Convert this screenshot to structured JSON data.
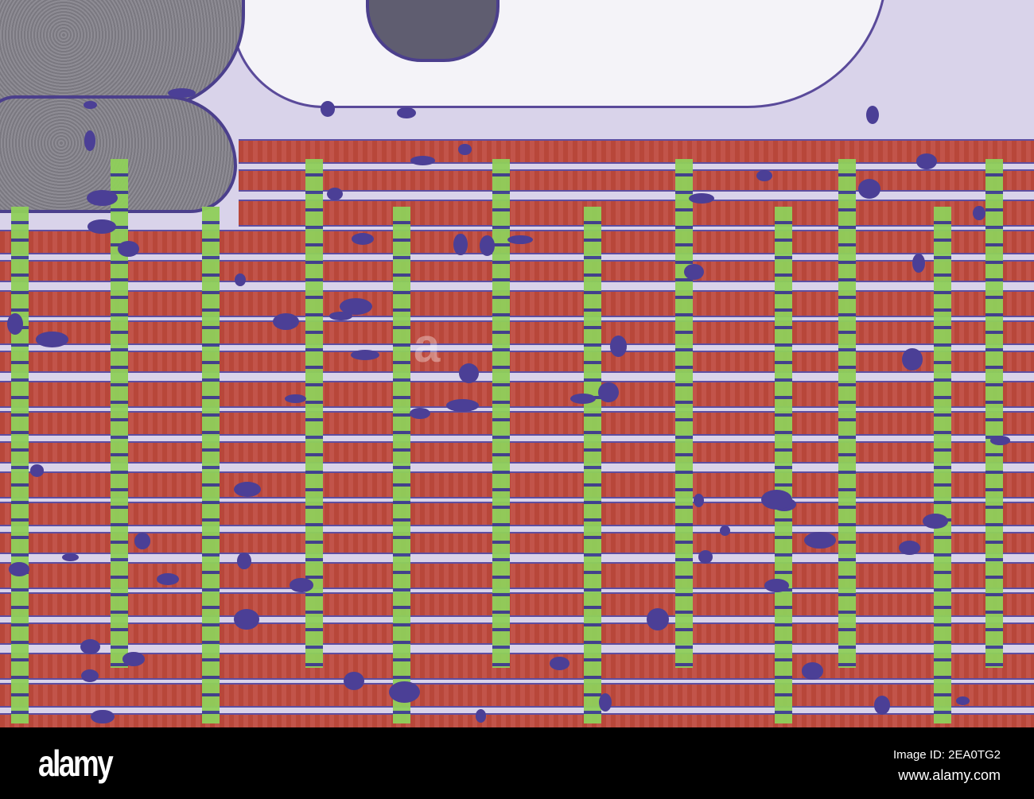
{
  "image": {
    "colors": {
      "myofibril": "#b8473a",
      "z_disc": "#8fcf5a",
      "mitochondria": "#4b3f96",
      "cytoplasm": "#d9d3ea",
      "nucleus": "#8e8c94"
    },
    "watermark": "alamy"
  },
  "footer": {
    "logo": "alamy",
    "image_id": "Image ID: 2EA0TG2",
    "url": "www.alamy.com"
  }
}
